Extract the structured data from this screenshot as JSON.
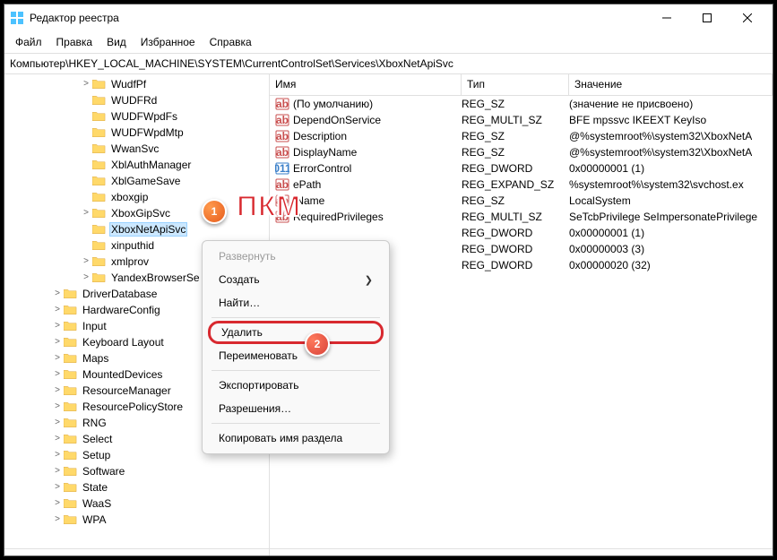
{
  "window": {
    "title": "Редактор реестра"
  },
  "menu": [
    "Файл",
    "Правка",
    "Вид",
    "Избранное",
    "Справка"
  ],
  "address": "Компьютер\\HKEY_LOCAL_MACHINE\\SYSTEM\\CurrentControlSet\\Services\\XboxNetApiSvc",
  "tree": [
    {
      "depth": 5,
      "exp": ">",
      "label": "WudfPf"
    },
    {
      "depth": 5,
      "exp": "",
      "label": "WUDFRd"
    },
    {
      "depth": 5,
      "exp": "",
      "label": "WUDFWpdFs"
    },
    {
      "depth": 5,
      "exp": "",
      "label": "WUDFWpdMtp"
    },
    {
      "depth": 5,
      "exp": "",
      "label": "WwanSvc"
    },
    {
      "depth": 5,
      "exp": "",
      "label": "XblAuthManager"
    },
    {
      "depth": 5,
      "exp": "",
      "label": "XblGameSave"
    },
    {
      "depth": 5,
      "exp": "",
      "label": "xboxgip"
    },
    {
      "depth": 5,
      "exp": ">",
      "label": "XboxGipSvc"
    },
    {
      "depth": 5,
      "exp": "",
      "label": "XboxNetApiSvc",
      "selected": true
    },
    {
      "depth": 5,
      "exp": "",
      "label": "xinputhid"
    },
    {
      "depth": 5,
      "exp": ">",
      "label": "xmlprov"
    },
    {
      "depth": 5,
      "exp": ">",
      "label": "YandexBrowserSe"
    },
    {
      "depth": 3,
      "exp": ">",
      "label": "DriverDatabase"
    },
    {
      "depth": 3,
      "exp": ">",
      "label": "HardwareConfig"
    },
    {
      "depth": 3,
      "exp": ">",
      "label": "Input"
    },
    {
      "depth": 3,
      "exp": ">",
      "label": "Keyboard Layout"
    },
    {
      "depth": 3,
      "exp": ">",
      "label": "Maps"
    },
    {
      "depth": 3,
      "exp": ">",
      "label": "MountedDevices"
    },
    {
      "depth": 3,
      "exp": ">",
      "label": "ResourceManager"
    },
    {
      "depth": 3,
      "exp": ">",
      "label": "ResourcePolicyStore"
    },
    {
      "depth": 3,
      "exp": ">",
      "label": "RNG"
    },
    {
      "depth": 3,
      "exp": ">",
      "label": "Select"
    },
    {
      "depth": 3,
      "exp": ">",
      "label": "Setup"
    },
    {
      "depth": 3,
      "exp": ">",
      "label": "Software"
    },
    {
      "depth": 3,
      "exp": ">",
      "label": "State"
    },
    {
      "depth": 3,
      "exp": ">",
      "label": "WaaS"
    },
    {
      "depth": 3,
      "exp": ">",
      "label": "WPA"
    }
  ],
  "list_headers": {
    "name": "Имя",
    "type": "Тип",
    "value": "Значение"
  },
  "values": [
    {
      "icon": "str",
      "name": "(По умолчанию)",
      "type": "REG_SZ",
      "data": "(значение не присвоено)"
    },
    {
      "icon": "str",
      "name": "DependOnService",
      "type": "REG_MULTI_SZ",
      "data": "BFE mpssvc IKEEXT KeyIso"
    },
    {
      "icon": "str",
      "name": "Description",
      "type": "REG_SZ",
      "data": "@%systemroot%\\system32\\XboxNetA"
    },
    {
      "icon": "str",
      "name": "DisplayName",
      "type": "REG_SZ",
      "data": "@%systemroot%\\system32\\XboxNetA"
    },
    {
      "icon": "bin",
      "name": "ErrorControl",
      "type": "REG_DWORD",
      "data": "0x00000001 (1)"
    },
    {
      "icon": "str",
      "name": "      ePath",
      "type": "REG_EXPAND_SZ",
      "data": "%systemroot%\\system32\\svchost.ex"
    },
    {
      "icon": "str",
      "name": "      tName",
      "type": "REG_SZ",
      "data": "LocalSystem"
    },
    {
      "icon": "str",
      "name": "RequiredPrivileges",
      "type": "REG_MULTI_SZ",
      "data": "SeTcbPrivilege SeImpersonatePrivilege"
    },
    {
      "icon": "",
      "name": "",
      "type": "REG_DWORD",
      "data": "0x00000001 (1)"
    },
    {
      "icon": "",
      "name": "",
      "type": "REG_DWORD",
      "data": "0x00000003 (3)"
    },
    {
      "icon": "",
      "name": "",
      "type": "REG_DWORD",
      "data": "0x00000020 (32)"
    }
  ],
  "context_menu": [
    {
      "label": "Развернуть",
      "disabled": true
    },
    {
      "label": "Создать",
      "sub": true
    },
    {
      "label": "Найти…"
    },
    {
      "sep": true
    },
    {
      "label": "Удалить",
      "highlight": true
    },
    {
      "label": "Переименовать"
    },
    {
      "sep": true
    },
    {
      "label": "Экспортировать"
    },
    {
      "label": "Разрешения…"
    },
    {
      "sep": true
    },
    {
      "label": "Копировать имя раздела"
    }
  ],
  "annotations": {
    "pkm": "ПКМ",
    "step1": "1",
    "step2": "2"
  }
}
